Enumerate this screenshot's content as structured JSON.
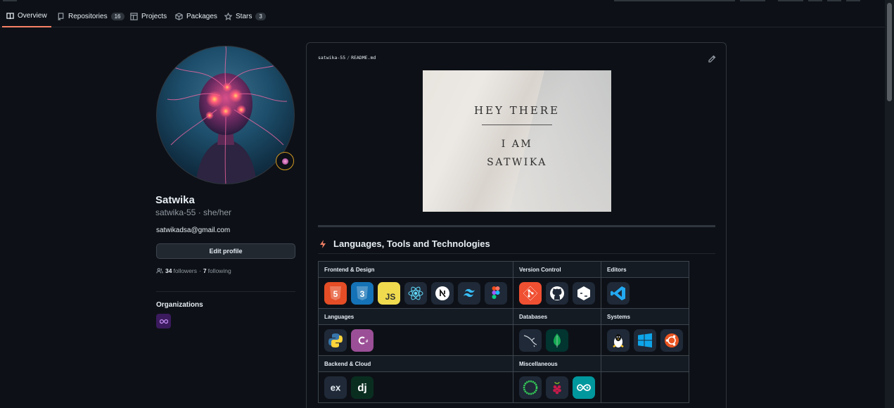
{
  "tabs": [
    {
      "label": "Overview",
      "icon": "book-icon",
      "active": true
    },
    {
      "label": "Repositories",
      "icon": "repo-icon",
      "count": "16"
    },
    {
      "label": "Projects",
      "icon": "table-icon"
    },
    {
      "label": "Packages",
      "icon": "package-icon"
    },
    {
      "label": "Stars",
      "icon": "star-icon",
      "count": "3"
    }
  ],
  "profile": {
    "name": "Satwika",
    "handle": "satwika-55",
    "pronouns": "she/her",
    "email": "satwikadsa@gmail.com",
    "edit_label": "Edit profile",
    "followers_count": "34",
    "followers_label": "followers",
    "following_count": "7",
    "following_label": "following"
  },
  "organizations": {
    "heading": "Organizations"
  },
  "readme": {
    "owner": "satwika-55",
    "file": "README.md",
    "banner_title": "HEY THERE",
    "banner_line1": "I AM",
    "banner_line2": "SATWIKA",
    "section_title": "Languages, Tools and Technologies"
  },
  "tools_table": {
    "row1": {
      "c1": "Frontend & Design",
      "c2": "Version Control",
      "c3": "Editors"
    },
    "row2": {
      "c1": "Languages",
      "c2": "Databases",
      "c3": "Systems"
    },
    "row3": {
      "c1": "Backend & Cloud",
      "c2": "Miscellaneous",
      "c3": ""
    }
  },
  "colors": {
    "accent_tab": "#f78166",
    "background": "#0d1117",
    "border": "#30363d"
  }
}
